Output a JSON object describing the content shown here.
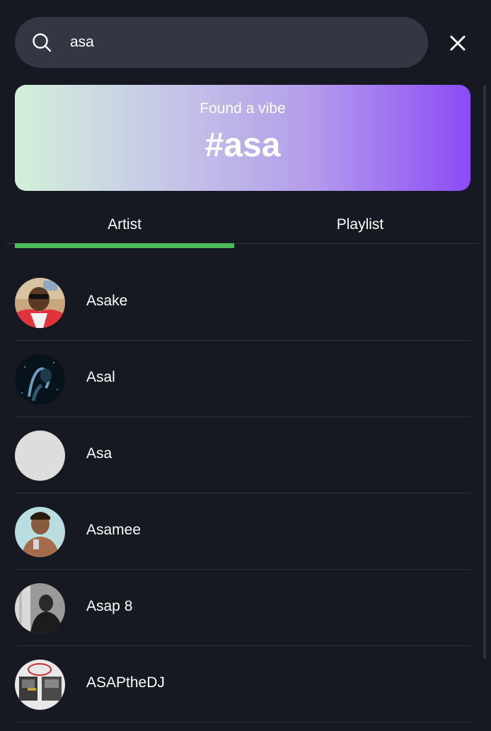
{
  "search": {
    "value": "asa",
    "icon": "search-icon"
  },
  "close": {
    "icon": "close-icon"
  },
  "vibe": {
    "subtitle": "Found a vibe",
    "tag": "#asa"
  },
  "tabs": [
    {
      "label": "Artist",
      "active": true
    },
    {
      "label": "Playlist",
      "active": false
    }
  ],
  "colors": {
    "background": "#161822",
    "accent": "#4dbd5c",
    "search_bg": "#343743",
    "gradient_start": "#d3f0d9",
    "gradient_end": "#8c4bf5"
  },
  "artists": [
    {
      "name": "Asake"
    },
    {
      "name": "Asal"
    },
    {
      "name": "Asa"
    },
    {
      "name": "Asamee"
    },
    {
      "name": "Asap 8"
    },
    {
      "name": "ASAPtheDJ"
    }
  ]
}
